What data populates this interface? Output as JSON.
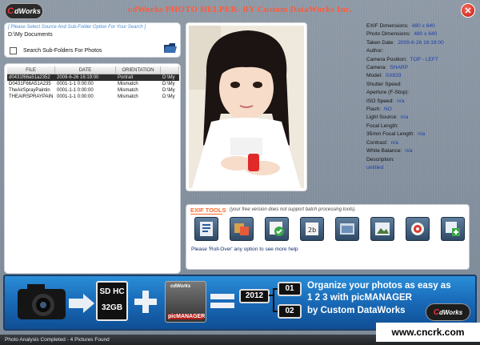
{
  "app": {
    "logo_text": "dWorks",
    "title": "cdWorks PHOTO HELPER- BY Custom DataWorks Inc."
  },
  "search": {
    "hint": "[ Please Select Source And Sub-Folder Option For Your Search ]",
    "path": "D:\\My Documents",
    "subfolder_label": "Search Sub-Folders For Photos"
  },
  "file_list": {
    "columns": [
      "FILE",
      "DATE",
      "ORIENTATION",
      ""
    ],
    "rows": [
      {
        "file": "d0431f66a51a2352",
        "date": "2009-6-26 16:19:00",
        "orientation": "Portrait",
        "path": "D:\\My"
      },
      {
        "file": "D0431F66A51A235",
        "date": "0001-1-1 0:00:00",
        "orientation": "Mismatch",
        "path": "D:\\My"
      },
      {
        "file": "TheAirSprayPaintin",
        "date": "0001-1-1 0:00:00",
        "orientation": "Mismatch",
        "path": "D:\\My"
      },
      {
        "file": "THEAIRSPRAYPAIN",
        "date": "0001-1-1 0:00:00",
        "orientation": "Mismatch",
        "path": "D:\\My"
      }
    ]
  },
  "exif": [
    {
      "label": "EXIF Dimensions:",
      "value": "480 x 640"
    },
    {
      "label": "Photo Dimensions:",
      "value": "480 x 640"
    },
    {
      "label": "Taken Date:",
      "value": "2009-6-26 16:19:00"
    },
    {
      "label": "Author:",
      "value": ""
    },
    {
      "label": "Camera Position:",
      "value": "TOP - LEFT"
    },
    {
      "label": "Camera:",
      "value": "SHARP"
    },
    {
      "label": "Model:",
      "value": "SX833"
    },
    {
      "label": "Shutter Speed:",
      "value": ""
    },
    {
      "label": "Aperture (F-Stop):",
      "value": ""
    },
    {
      "label": "ISO Speed:",
      "value": "n/a"
    },
    {
      "label": "Flash:",
      "value": "NO"
    },
    {
      "label": "Light Source:",
      "value": "n/a"
    },
    {
      "label": "Focal Length:",
      "value": ""
    },
    {
      "label": "35mm Focal Length:",
      "value": "n/a"
    },
    {
      "label": "Contrast:",
      "value": "n/a"
    },
    {
      "label": "White Balance:",
      "value": "n/a"
    },
    {
      "label": "Description:",
      "value": ""
    },
    {
      "label": "untitled",
      "value": ""
    }
  ],
  "tools": {
    "title": "EXIF TOOLS",
    "note": "(your free version does not support batch processing tools).",
    "help": "Please 'Roll-Over' any option to see more help",
    "icons": [
      "exif-info-icon",
      "convert-icon",
      "exif-accept-icon",
      "exif-2b-icon",
      "image-window-icon",
      "image-view-icon",
      "focus-target-icon",
      "add-image-icon"
    ]
  },
  "banner": {
    "sd_label": "SD HC",
    "sd_size": "32GB",
    "pm_logo": "cdWorks",
    "pm_label": "picMANAGER",
    "year": "2012",
    "num1": "01",
    "num2": "02",
    "line1": "Organize your photos as easy as",
    "line2": "1 2 3 with picMANAGER",
    "line3": "by Custom DataWorks",
    "logo_text": "dWorks"
  },
  "status": "Photo Analysis Completed - 4 Pictures Found",
  "watermark": "www.cncrk.com"
}
